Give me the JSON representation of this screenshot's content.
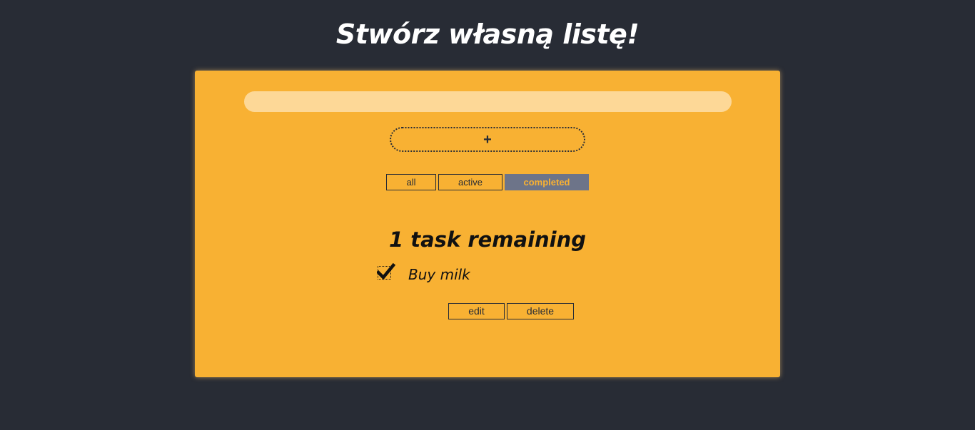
{
  "header": {
    "title": "Stwórz własną listę!"
  },
  "form": {
    "input_value": "",
    "input_placeholder": "",
    "add_label": "+"
  },
  "filters": {
    "all_label": "all",
    "active_label": "active",
    "completed_label": "completed",
    "selected": "completed"
  },
  "summary": {
    "remaining_text": "1 task remaining"
  },
  "todos": [
    {
      "label": "Buy milk",
      "checked": true,
      "edit_label": "edit",
      "delete_label": "delete"
    }
  ],
  "colors": {
    "background": "#282c35",
    "card": "#f8b133",
    "input": "#fdd897",
    "selected_filter": "#6d7489",
    "text_dark": "#282c35"
  },
  "icons": {
    "checkbox": "checkmark-icon"
  }
}
